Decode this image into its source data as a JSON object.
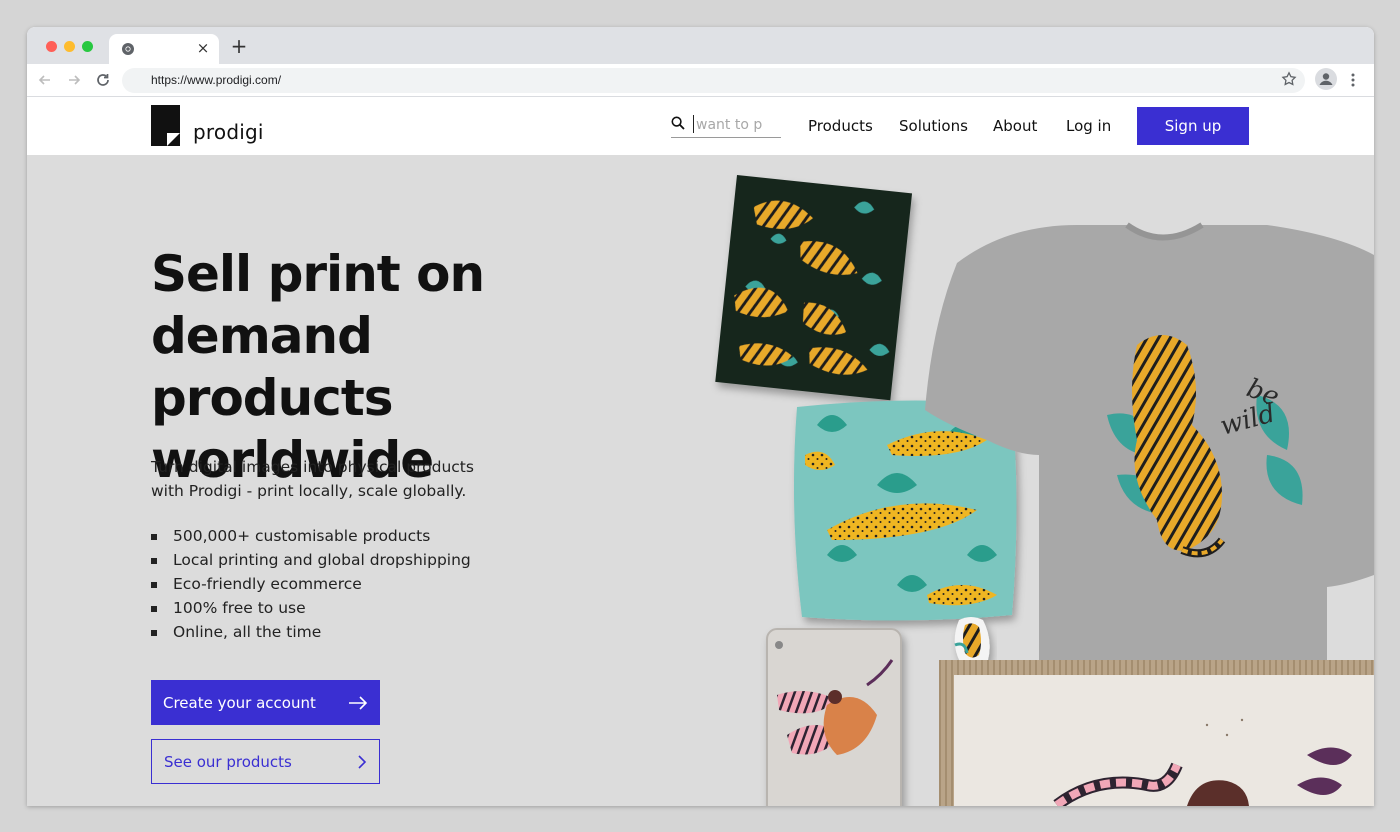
{
  "browser": {
    "tab_close": "×",
    "new_tab": "+",
    "url": "https://www.prodigi.com/"
  },
  "site": {
    "logo_text": "prodigi",
    "search_placeholder": "want to p",
    "nav": [
      "Products",
      "Solutions",
      "About",
      "Log in"
    ],
    "signup_label": "Sign up"
  },
  "hero": {
    "headline": [
      "Sell print on",
      "demand products",
      "worldwide"
    ],
    "subtext": [
      "Turn digital images into physical products",
      "with Prodigi - print locally, scale globally."
    ],
    "features": [
      "500,000+ customisable products",
      "Local printing and global dropshipping",
      "Eco-friendly ecommerce",
      "100% free to use",
      "Online, all the time"
    ],
    "primary_cta": "Create your account",
    "secondary_cta": "See our products",
    "tshirt_text": [
      "be",
      "wild"
    ]
  },
  "colors": {
    "brand": "#3a2fd2",
    "hero_bg": "#dcdcdc",
    "tiger_orange": "#e8a92a",
    "leaf_teal": "#3aa39a"
  },
  "icons": {
    "search": "search-icon",
    "arrow": "arrow-right-icon",
    "chevron": "chevron-right-icon"
  }
}
